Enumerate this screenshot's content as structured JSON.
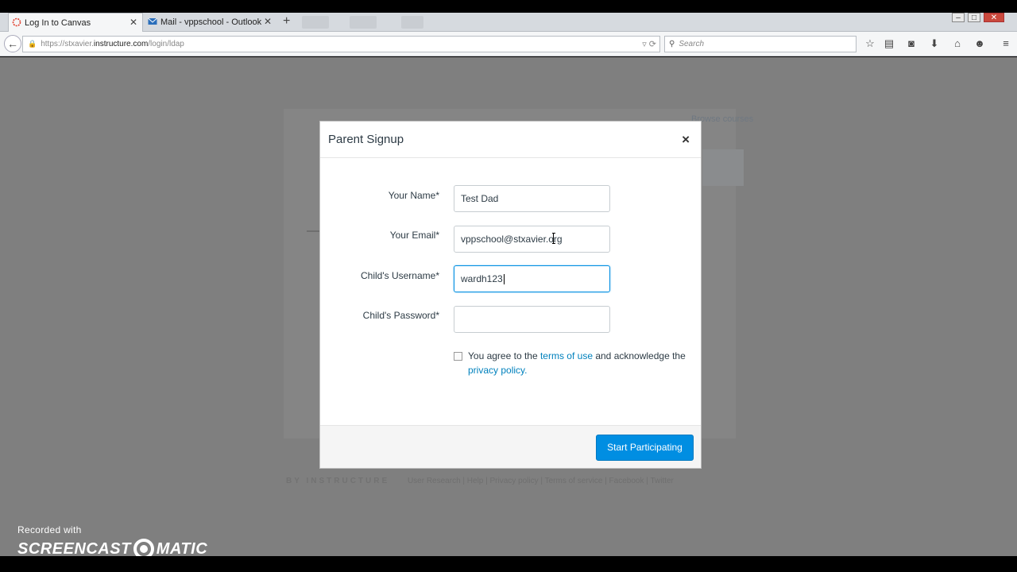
{
  "browser": {
    "tabs": [
      {
        "label": "Log In to Canvas",
        "active": true,
        "icon": "canvas-icon"
      },
      {
        "label": "Mail - vppschool - Outlook",
        "active": false,
        "icon": "mail-icon"
      }
    ],
    "url": {
      "prefix": "https://stxavier.",
      "domain": "instructure.com",
      "path": "/login/ldap"
    },
    "search_placeholder": "Search"
  },
  "background_page": {
    "browse_link": "Browse courses",
    "footer_brand": "BY INSTRUCTURE",
    "footer_links": "User Research | Help | Privacy policy | Terms of service | Facebook | Twitter"
  },
  "modal": {
    "title": "Parent Signup",
    "close_label": "×",
    "fields": [
      {
        "label": "Your Name*",
        "value": "Test Dad",
        "focused": false
      },
      {
        "label": "Your Email*",
        "value": "vppschool@stxavier.org",
        "focused": false
      },
      {
        "label": "Child's Username*",
        "value": "wardh123",
        "focused": true
      },
      {
        "label": "Child's Password*",
        "value": "",
        "focused": false
      }
    ],
    "agree": {
      "prefix": "You agree to the ",
      "terms_link": "terms of use",
      "middle": " and acknowledge the ",
      "privacy_link": "privacy policy",
      "suffix": ".",
      "checked": false
    },
    "submit_label": "Start Participating"
  },
  "watermark": {
    "line1": "Recorded with",
    "line2a": "SCREENCAST",
    "line2b": "MATIC"
  },
  "colors": {
    "accent": "#008ee2",
    "link": "#0081bd",
    "overlay": "#7f7f7f"
  }
}
